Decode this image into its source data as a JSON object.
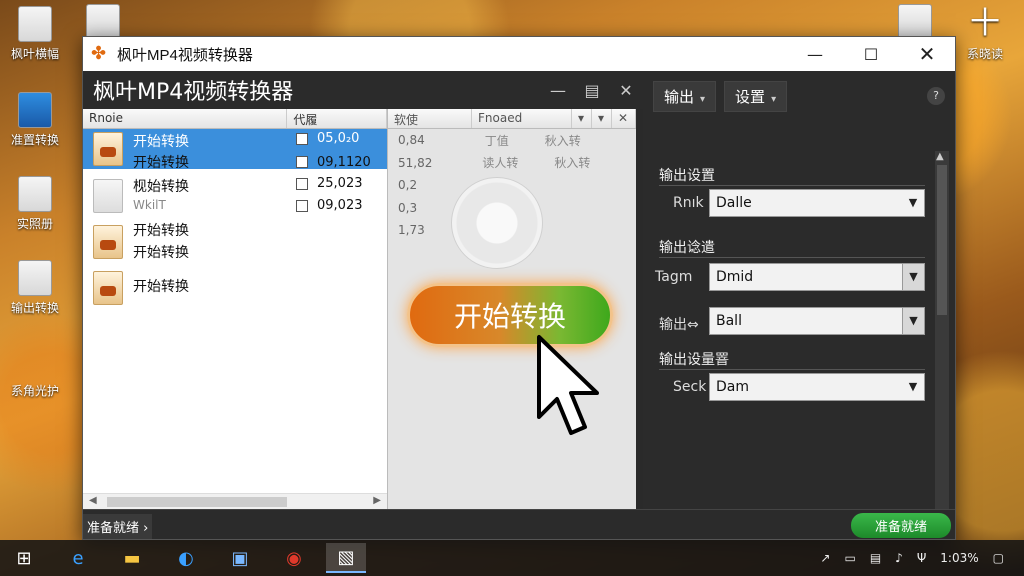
{
  "desktop": {
    "icons": [
      {
        "label": "枫叶横幅"
      },
      {
        "label": "准置转换"
      },
      {
        "label": "实照册"
      },
      {
        "label": "输出转换"
      },
      {
        "label": "系角光护"
      },
      {
        "label": "系晓读"
      }
    ]
  },
  "window": {
    "title": "枫叶MP4视频转换器",
    "app_heading": "枫叶MP4视频转换器",
    "controls": {
      "minimize": "—",
      "maximize": "☐",
      "close": "✕"
    }
  },
  "filelist": {
    "headers": [
      "Rnoie",
      "代履"
    ],
    "rows": [
      {
        "name": "开始转换",
        "value": "05,0₂0",
        "selected": true
      },
      {
        "name": "开始转换",
        "value": "09,1120",
        "selected": false
      },
      {
        "name": "枧始转换",
        "value": "25,023",
        "selected": false
      },
      {
        "name": "WkilT",
        "value": "09,023",
        "selected": false
      },
      {
        "name": "开始转换",
        "value": "",
        "selected": false
      },
      {
        "name": "开始转换",
        "value": "",
        "selected": false
      },
      {
        "name": "开始转换",
        "value": "",
        "selected": false
      }
    ]
  },
  "midcol": {
    "headers": [
      "软使",
      "Fnoaed"
    ],
    "rows": [
      {
        "a": "0,84",
        "b": "丁值",
        "c": "秋入转"
      },
      {
        "a": "51,82",
        "b": "读人转",
        "c": "秋入转"
      },
      {
        "a": "0,2",
        "b": "",
        "c": ""
      },
      {
        "a": "0,3",
        "b": "",
        "c": ""
      },
      {
        "a": "1,73",
        "b": "",
        "c": ""
      }
    ]
  },
  "start_button": {
    "label": "开始转换"
  },
  "settings": {
    "tab_output": "输出",
    "tab_settings": "设置",
    "help": "?",
    "sections": [
      {
        "title": "输出设置",
        "label": "Rnık",
        "value": "Dalle"
      },
      {
        "title": "输出谂遣",
        "label": "Tagm",
        "value": "Dmid"
      },
      {
        "title": "",
        "label": "输出⇔",
        "value": "Ball"
      },
      {
        "title": "输出设量罯",
        "label": "Seck",
        "value": "Dam"
      }
    ]
  },
  "statusbar": {
    "left": "准备就绪 ›",
    "right": "准备就绪"
  },
  "taskbar": {
    "clock": "1:03%"
  },
  "colors": {
    "accent": "#3b8fdc",
    "start_orange": "#e06a10",
    "start_green": "#3ea81c"
  }
}
